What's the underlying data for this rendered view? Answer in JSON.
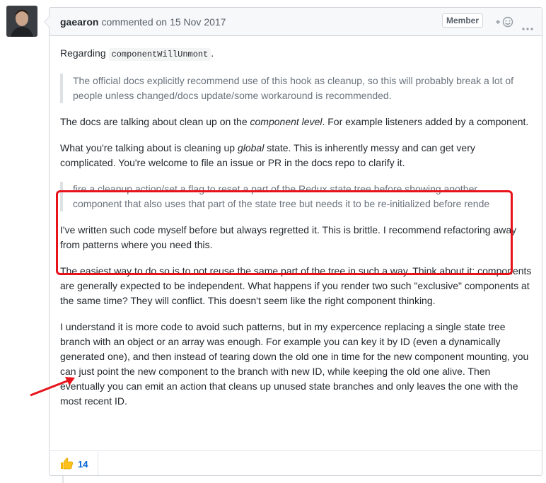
{
  "comment": {
    "author": "gaearon",
    "action": "commented on",
    "date": "15 Nov 2017",
    "badge": "Member"
  },
  "body": {
    "p1_prefix": "Regarding ",
    "p1_code": "componentWillUnmont",
    "p1_suffix": ".",
    "quote1": "The official docs explicitly recommend use of this hook as cleanup, so this will probably break a lot of people unless changed/docs update/some workaround is recommended.",
    "p2_prefix": "The docs are talking about clean up on the ",
    "p2_em": "component level",
    "p2_suffix": ". For example listeners added by a component.",
    "p3_prefix": "What you're talking about is cleaning up ",
    "p3_em": "global",
    "p3_suffix": " state. This is inherently messy and can get very complicated. You're welcome to file an issue or PR in the docs repo to clarify it.",
    "quote2_line1": "fire a cleanup action/set a flag to reset a part of the Redux state tree before showing another",
    "quote2_line2": "component that also uses that part of the state tree but needs it to be re-initialized before rende",
    "p4": "I've written such code myself before but always regretted it. This is brittle. I recommend refactoring away from patterns where you need this.",
    "p5": "The easiest way to do so is to not reuse the same part of the tree in such a way. Think about it: components are generally expected to be independent. What happens if you render two such \"exclusive\" components at the same time? They will conflict. This doesn't seem like the right component thinking.",
    "p6": "I understand it is more code to avoid such patterns, but in my expercence replacing a single state tree branch with an object or an array was enough. For example you can key it by ID (even a dynamically generated one), and then instead of tearing down the old one in time for the new component mounting, you can just point the new component to the branch with new ID, while keeping the old one alive. Then eventually you can emit an action that cleans up unused state branches and only leaves the one with the most recent ID."
  },
  "reactions": {
    "thumbs_up_count": "14"
  },
  "icons": {
    "reaction": "add-reaction-icon",
    "more": "kebab-icon",
    "thumbs": "thumbs-up-icon"
  },
  "colors": {
    "annotation_red": "#e8121a",
    "link_blue": "#0366d6"
  }
}
